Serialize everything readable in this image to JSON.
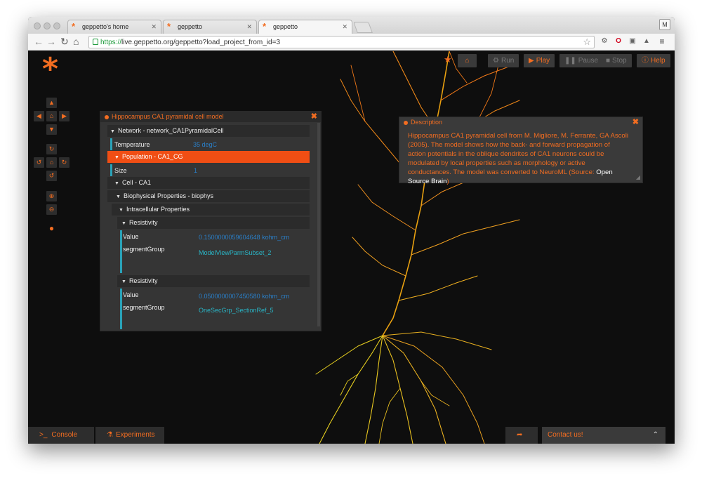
{
  "browser": {
    "tabs": [
      {
        "title": "geppetto's home"
      },
      {
        "title": "geppetto"
      },
      {
        "title": "geppetto"
      }
    ],
    "user_initial": "M",
    "url_protocol": "https://",
    "url_rest": "live.geppetto.org/geppetto?load_project_from_id=3"
  },
  "app": {
    "logo": "*",
    "toolbar": {
      "run": "Run",
      "play": "Play",
      "pause": "Pause",
      "stop": "Stop",
      "help": "Help"
    },
    "model_panel": {
      "title": "Hippocampus CA1 pyramidal cell model",
      "network": "Network - network_CA1PyramidalCell",
      "temperature_label": "Temperature",
      "temperature_value": "35 degC",
      "population": "Population - CA1_CG",
      "size_label": "Size",
      "size_value": "1",
      "cell": "Cell - CA1",
      "biophysical": "Biophysical Properties - biophys",
      "intracellular": "Intracellular Properties",
      "resistivity_1": {
        "label": "Resistivity",
        "value_label": "Value",
        "value": "0.1500000059604648 kohm_cm",
        "segment_label": "segmentGroup",
        "segment": "ModelViewParmSubset_2"
      },
      "resistivity_2": {
        "label": "Resistivity",
        "value_label": "Value",
        "value": "0.0500000007450580 kohm_cm",
        "segment_label": "segmentGroup",
        "segment": "OneSecGrp_SectionRef_5"
      }
    },
    "description_panel": {
      "title": "Description",
      "text": "Hippocampus CA1 pyramidal cell from M. Migliore, M. Ferrante, GA Ascoli (2005). The model shows how the back- and forward propagation of action potentials in the oblique dendrites of CA1 neurons could be modulated by local properties such as morphology or active conductances. The model was converted to NeuroML (Source: ",
      "link": "Open Source Brain",
      "text_end": ")"
    },
    "footer": {
      "console": "Console",
      "experiments": "Experiments",
      "contact": "Contact us!"
    }
  },
  "colors": {
    "accent": "#f26d21",
    "selected": "#f04e14",
    "background": "#0e0e0e"
  }
}
